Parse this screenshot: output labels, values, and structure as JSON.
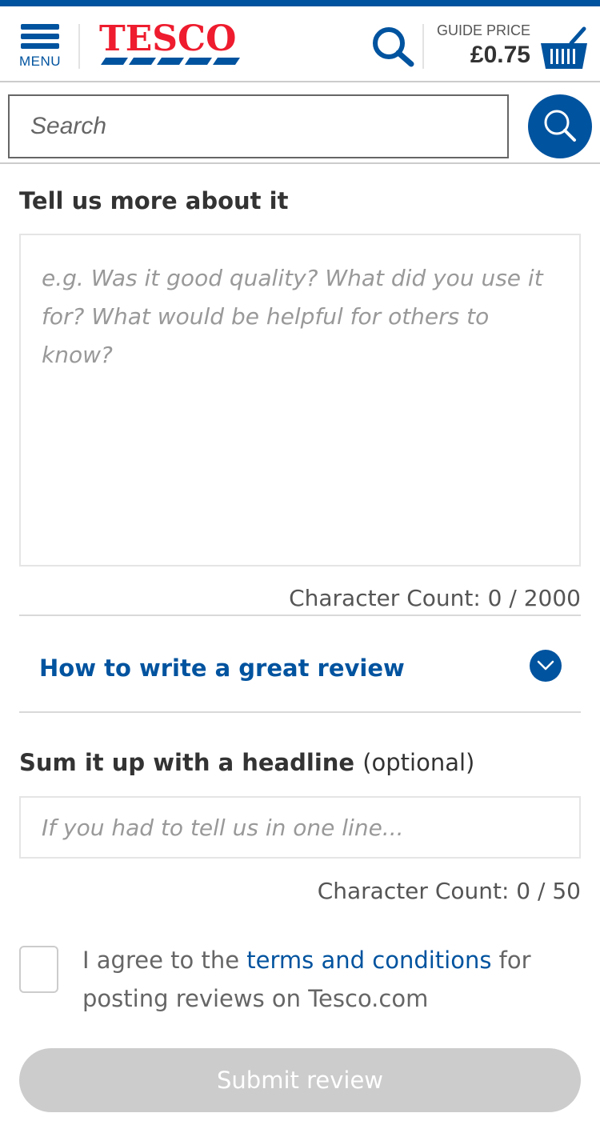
{
  "colors": {
    "brand_blue": "#00539f",
    "brand_red": "#ee1c2e",
    "disabled_gray": "#cccccc"
  },
  "header": {
    "menu_label": "MENU",
    "logo_text": "TESCO",
    "guide_price_label": "GUIDE PRICE",
    "guide_price_value": "£0.75",
    "icons": [
      "hamburger-menu-icon",
      "search-icon",
      "basket-icon"
    ]
  },
  "search": {
    "placeholder": "Search",
    "button_icon": "search-icon"
  },
  "review": {
    "title": "Tell us more about it",
    "placeholder": "e.g. Was it good quality? What did you use it for? What would be helpful for others to know?",
    "char_count": "Character Count: 0 / 2000"
  },
  "howto": {
    "label": "How to write a great review",
    "icon": "chevron-down-icon"
  },
  "headline": {
    "title": "Sum it up with a headline",
    "optional": "(optional)",
    "placeholder": "If you had to tell us in one line...",
    "char_count": "Character Count: 0 / 50"
  },
  "terms": {
    "prefix": "I agree to the ",
    "link": "terms and conditions",
    "suffix": " for posting reviews on Tesco.com",
    "checked": false
  },
  "submit": {
    "label": "Submit review",
    "enabled": false
  }
}
